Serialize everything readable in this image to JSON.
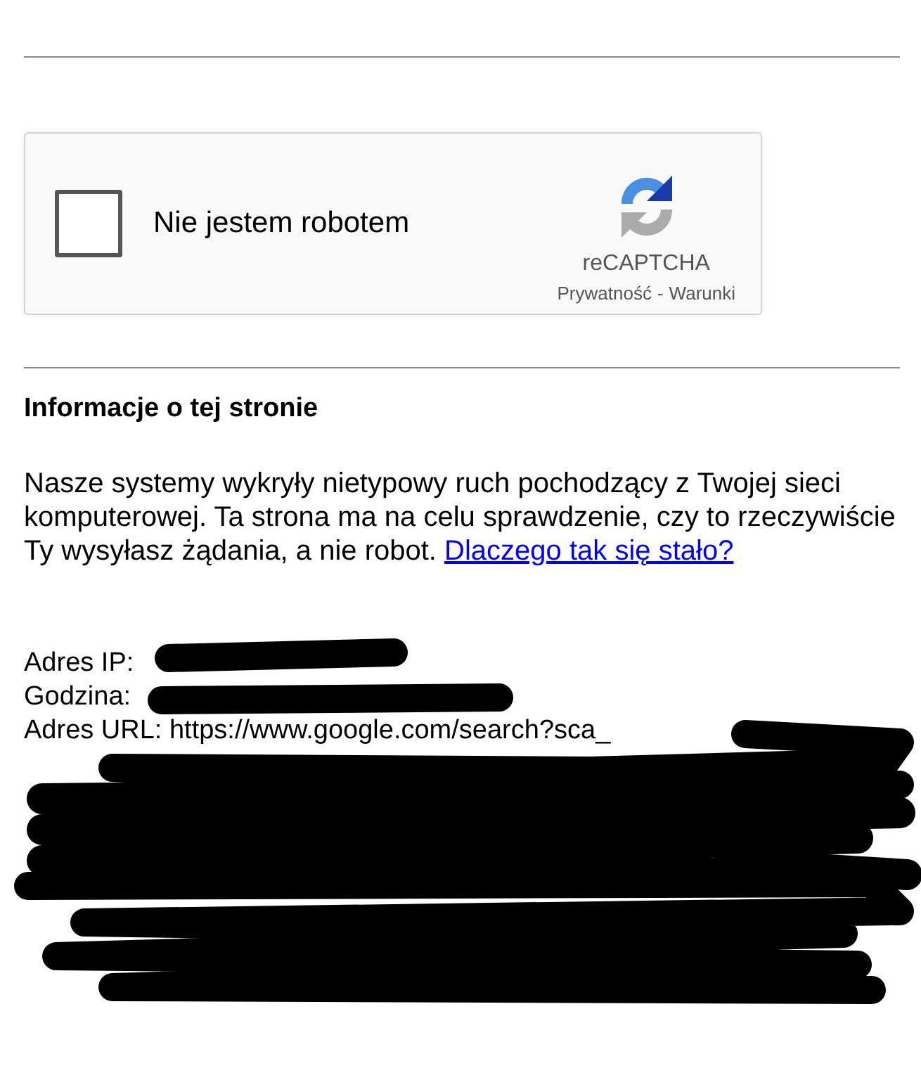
{
  "captcha": {
    "label": "Nie jestem robotem",
    "checked": false,
    "brand": "reCAPTCHA",
    "privacy_link": "Prywatność",
    "separator": "-",
    "terms_link": "Warunki"
  },
  "info": {
    "heading": "Informacje o tej stronie",
    "paragraph": "Nasze systemy wykryły nietypowy ruch pochodzący z Twojej sieci komputerowej. Ta strona ma na celu sprawdzenie, czy to rzeczywiście Ty wysyłasz żądania, a nie robot.",
    "link": "Dlaczego tak się stało?"
  },
  "details": [
    {
      "label": "Adres IP:"
    },
    {
      "label": "Godzina:"
    },
    {
      "label": "Adres URL:",
      "value": "https://www.google.com/search?sca_"
    }
  ]
}
